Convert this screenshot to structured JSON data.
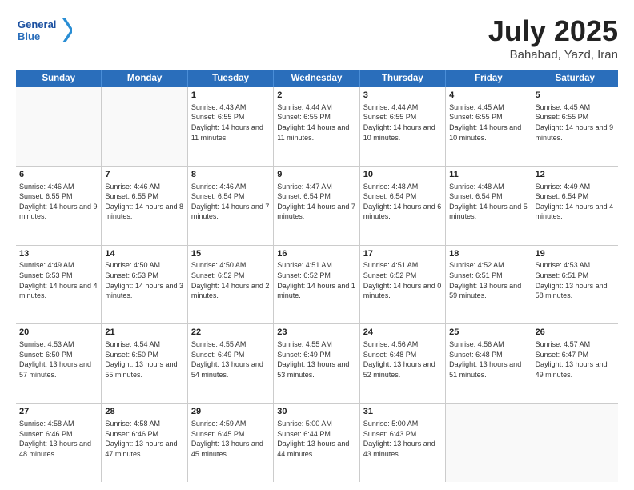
{
  "header": {
    "logo_line1": "General",
    "logo_line2": "Blue",
    "title": "July 2025",
    "location": "Bahabad, Yazd, Iran"
  },
  "days_of_week": [
    "Sunday",
    "Monday",
    "Tuesday",
    "Wednesday",
    "Thursday",
    "Friday",
    "Saturday"
  ],
  "weeks": [
    [
      {
        "day": "",
        "sunrise": "",
        "sunset": "",
        "daylight": ""
      },
      {
        "day": "",
        "sunrise": "",
        "sunset": "",
        "daylight": ""
      },
      {
        "day": "1",
        "sunrise": "Sunrise: 4:43 AM",
        "sunset": "Sunset: 6:55 PM",
        "daylight": "Daylight: 14 hours and 11 minutes."
      },
      {
        "day": "2",
        "sunrise": "Sunrise: 4:44 AM",
        "sunset": "Sunset: 6:55 PM",
        "daylight": "Daylight: 14 hours and 11 minutes."
      },
      {
        "day": "3",
        "sunrise": "Sunrise: 4:44 AM",
        "sunset": "Sunset: 6:55 PM",
        "daylight": "Daylight: 14 hours and 10 minutes."
      },
      {
        "day": "4",
        "sunrise": "Sunrise: 4:45 AM",
        "sunset": "Sunset: 6:55 PM",
        "daylight": "Daylight: 14 hours and 10 minutes."
      },
      {
        "day": "5",
        "sunrise": "Sunrise: 4:45 AM",
        "sunset": "Sunset: 6:55 PM",
        "daylight": "Daylight: 14 hours and 9 minutes."
      }
    ],
    [
      {
        "day": "6",
        "sunrise": "Sunrise: 4:46 AM",
        "sunset": "Sunset: 6:55 PM",
        "daylight": "Daylight: 14 hours and 9 minutes."
      },
      {
        "day": "7",
        "sunrise": "Sunrise: 4:46 AM",
        "sunset": "Sunset: 6:55 PM",
        "daylight": "Daylight: 14 hours and 8 minutes."
      },
      {
        "day": "8",
        "sunrise": "Sunrise: 4:46 AM",
        "sunset": "Sunset: 6:54 PM",
        "daylight": "Daylight: 14 hours and 7 minutes."
      },
      {
        "day": "9",
        "sunrise": "Sunrise: 4:47 AM",
        "sunset": "Sunset: 6:54 PM",
        "daylight": "Daylight: 14 hours and 7 minutes."
      },
      {
        "day": "10",
        "sunrise": "Sunrise: 4:48 AM",
        "sunset": "Sunset: 6:54 PM",
        "daylight": "Daylight: 14 hours and 6 minutes."
      },
      {
        "day": "11",
        "sunrise": "Sunrise: 4:48 AM",
        "sunset": "Sunset: 6:54 PM",
        "daylight": "Daylight: 14 hours and 5 minutes."
      },
      {
        "day": "12",
        "sunrise": "Sunrise: 4:49 AM",
        "sunset": "Sunset: 6:54 PM",
        "daylight": "Daylight: 14 hours and 4 minutes."
      }
    ],
    [
      {
        "day": "13",
        "sunrise": "Sunrise: 4:49 AM",
        "sunset": "Sunset: 6:53 PM",
        "daylight": "Daylight: 14 hours and 4 minutes."
      },
      {
        "day": "14",
        "sunrise": "Sunrise: 4:50 AM",
        "sunset": "Sunset: 6:53 PM",
        "daylight": "Daylight: 14 hours and 3 minutes."
      },
      {
        "day": "15",
        "sunrise": "Sunrise: 4:50 AM",
        "sunset": "Sunset: 6:52 PM",
        "daylight": "Daylight: 14 hours and 2 minutes."
      },
      {
        "day": "16",
        "sunrise": "Sunrise: 4:51 AM",
        "sunset": "Sunset: 6:52 PM",
        "daylight": "Daylight: 14 hours and 1 minute."
      },
      {
        "day": "17",
        "sunrise": "Sunrise: 4:51 AM",
        "sunset": "Sunset: 6:52 PM",
        "daylight": "Daylight: 14 hours and 0 minutes."
      },
      {
        "day": "18",
        "sunrise": "Sunrise: 4:52 AM",
        "sunset": "Sunset: 6:51 PM",
        "daylight": "Daylight: 13 hours and 59 minutes."
      },
      {
        "day": "19",
        "sunrise": "Sunrise: 4:53 AM",
        "sunset": "Sunset: 6:51 PM",
        "daylight": "Daylight: 13 hours and 58 minutes."
      }
    ],
    [
      {
        "day": "20",
        "sunrise": "Sunrise: 4:53 AM",
        "sunset": "Sunset: 6:50 PM",
        "daylight": "Daylight: 13 hours and 57 minutes."
      },
      {
        "day": "21",
        "sunrise": "Sunrise: 4:54 AM",
        "sunset": "Sunset: 6:50 PM",
        "daylight": "Daylight: 13 hours and 55 minutes."
      },
      {
        "day": "22",
        "sunrise": "Sunrise: 4:55 AM",
        "sunset": "Sunset: 6:49 PM",
        "daylight": "Daylight: 13 hours and 54 minutes."
      },
      {
        "day": "23",
        "sunrise": "Sunrise: 4:55 AM",
        "sunset": "Sunset: 6:49 PM",
        "daylight": "Daylight: 13 hours and 53 minutes."
      },
      {
        "day": "24",
        "sunrise": "Sunrise: 4:56 AM",
        "sunset": "Sunset: 6:48 PM",
        "daylight": "Daylight: 13 hours and 52 minutes."
      },
      {
        "day": "25",
        "sunrise": "Sunrise: 4:56 AM",
        "sunset": "Sunset: 6:48 PM",
        "daylight": "Daylight: 13 hours and 51 minutes."
      },
      {
        "day": "26",
        "sunrise": "Sunrise: 4:57 AM",
        "sunset": "Sunset: 6:47 PM",
        "daylight": "Daylight: 13 hours and 49 minutes."
      }
    ],
    [
      {
        "day": "27",
        "sunrise": "Sunrise: 4:58 AM",
        "sunset": "Sunset: 6:46 PM",
        "daylight": "Daylight: 13 hours and 48 minutes."
      },
      {
        "day": "28",
        "sunrise": "Sunrise: 4:58 AM",
        "sunset": "Sunset: 6:46 PM",
        "daylight": "Daylight: 13 hours and 47 minutes."
      },
      {
        "day": "29",
        "sunrise": "Sunrise: 4:59 AM",
        "sunset": "Sunset: 6:45 PM",
        "daylight": "Daylight: 13 hours and 45 minutes."
      },
      {
        "day": "30",
        "sunrise": "Sunrise: 5:00 AM",
        "sunset": "Sunset: 6:44 PM",
        "daylight": "Daylight: 13 hours and 44 minutes."
      },
      {
        "day": "31",
        "sunrise": "Sunrise: 5:00 AM",
        "sunset": "Sunset: 6:43 PM",
        "daylight": "Daylight: 13 hours and 43 minutes."
      },
      {
        "day": "",
        "sunrise": "",
        "sunset": "",
        "daylight": ""
      },
      {
        "day": "",
        "sunrise": "",
        "sunset": "",
        "daylight": ""
      }
    ]
  ]
}
